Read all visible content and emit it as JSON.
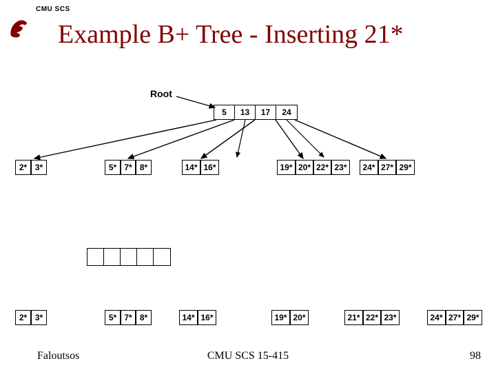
{
  "header": {
    "institution": "CMU SCS",
    "title": "Example B+ Tree - Inserting 21*"
  },
  "root_label": "Root",
  "tree1": {
    "root": [
      "5",
      "13",
      "17",
      "24"
    ],
    "leaves": [
      [
        "2*",
        "3*"
      ],
      [
        "5*",
        "7*",
        "8*"
      ],
      [
        "14*",
        "16*"
      ],
      [
        "19*",
        "20*",
        "22*",
        "23*"
      ],
      [
        "24*",
        "27*",
        "29*"
      ]
    ]
  },
  "tree2": {
    "root_cells": 5,
    "leaves": [
      [
        "2*",
        "3*"
      ],
      [
        "5*",
        "7*",
        "8*"
      ],
      [
        "14*",
        "16*"
      ],
      [
        "19*",
        "20*"
      ],
      [
        "21*",
        "22*",
        "23*"
      ],
      [
        "24*",
        "27*",
        "29*"
      ]
    ]
  },
  "footer": {
    "author": "Faloutsos",
    "course": "CMU SCS 15-415",
    "slide": "98"
  },
  "colors": {
    "brand": "#800000"
  }
}
